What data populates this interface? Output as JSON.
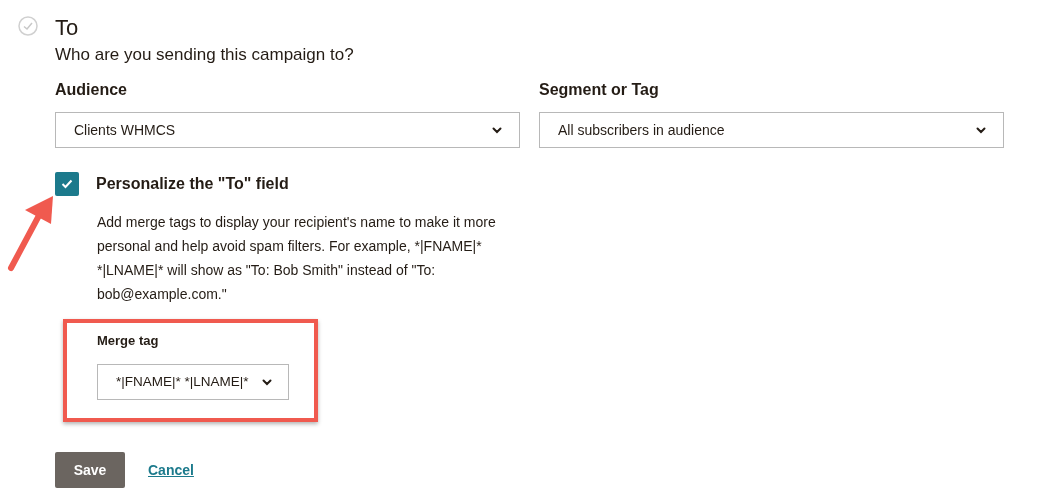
{
  "section": {
    "title": "To",
    "subtitle": "Who are you sending this campaign to?"
  },
  "audience": {
    "label": "Audience",
    "value": "Clients WHMCS"
  },
  "segment": {
    "label": "Segment or Tag",
    "value": "All subscribers in audience"
  },
  "personalize": {
    "label": "Personalize the \"To\" field",
    "checked": true,
    "description": "Add merge tags to display your recipient's name to make it more personal and help avoid spam filters. For example, *|FNAME|* *|LNAME|* will show as \"To: Bob Smith\" instead of \"To: bob@example.com.\""
  },
  "merge_tag": {
    "label": "Merge tag",
    "value": "*|FNAME|* *|LNAME|*"
  },
  "buttons": {
    "save": "Save",
    "cancel": "Cancel"
  }
}
